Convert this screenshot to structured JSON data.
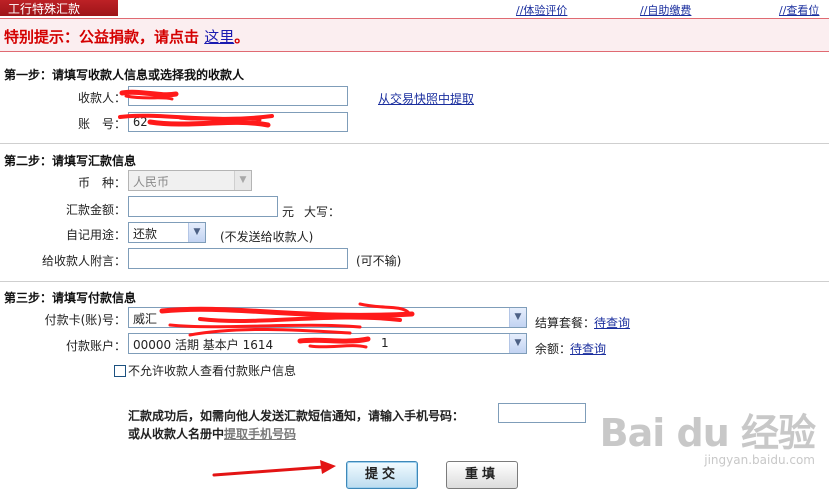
{
  "header": {
    "tab_title": "工行特殊汇款",
    "links": [
      "//体验评价",
      "//自助缴费",
      "//查看位"
    ]
  },
  "notice": {
    "text": "特别提示：公益捐款，请点击 ",
    "link_text": "这里",
    "suffix": "。"
  },
  "step1": {
    "title": "第一步：请填写收款人信息或选择我的收款人",
    "payee_label": "收款人：",
    "payee_value": "",
    "account_label": "账　号：",
    "account_value": "62",
    "snapshot_link": "从交易快照中提取"
  },
  "step2": {
    "title": "第二步：请填写汇款信息",
    "currency_label": "币　种：",
    "currency_value": "人民币",
    "amount_label": "汇款金额：",
    "amount_value": "",
    "amount_unit": "元",
    "uppercase_label": "大写：",
    "purpose_label": "自记用途：",
    "purpose_value": "还款",
    "purpose_note": "(不发送给收款人)",
    "message_label": "给收款人附言：",
    "message_value": "",
    "message_note": "(可不输)"
  },
  "step3": {
    "title": "第三步：请填写付款信息",
    "card_label": "付款卡(账)号：",
    "card_value": "威汇",
    "package_label": "结算套餐：",
    "package_link": "待查询",
    "account_label": "付款账户：",
    "account_value": "00000  活期  基本户  1614",
    "account_tail": "1",
    "balance_label": "余额：",
    "balance_link": "待查询",
    "deny_view_label": "不允许收款人查看付款账户信息"
  },
  "sms": {
    "line1": "汇款成功后，如需向他人发送汇款短信通知，请输入手机号码：",
    "line2_prefix": "或从收款人名册中",
    "line2_link": "提取手机号码",
    "phone_value": ""
  },
  "buttons": {
    "submit": "提交",
    "reset": "重填"
  },
  "watermark": {
    "logo": "Bai du 经验",
    "url": "jingyan.baidu.com"
  },
  "colors": {
    "notice_red": "#d40000",
    "link_blue": "#1a2e9e",
    "redaction": "#ff1a1a"
  }
}
